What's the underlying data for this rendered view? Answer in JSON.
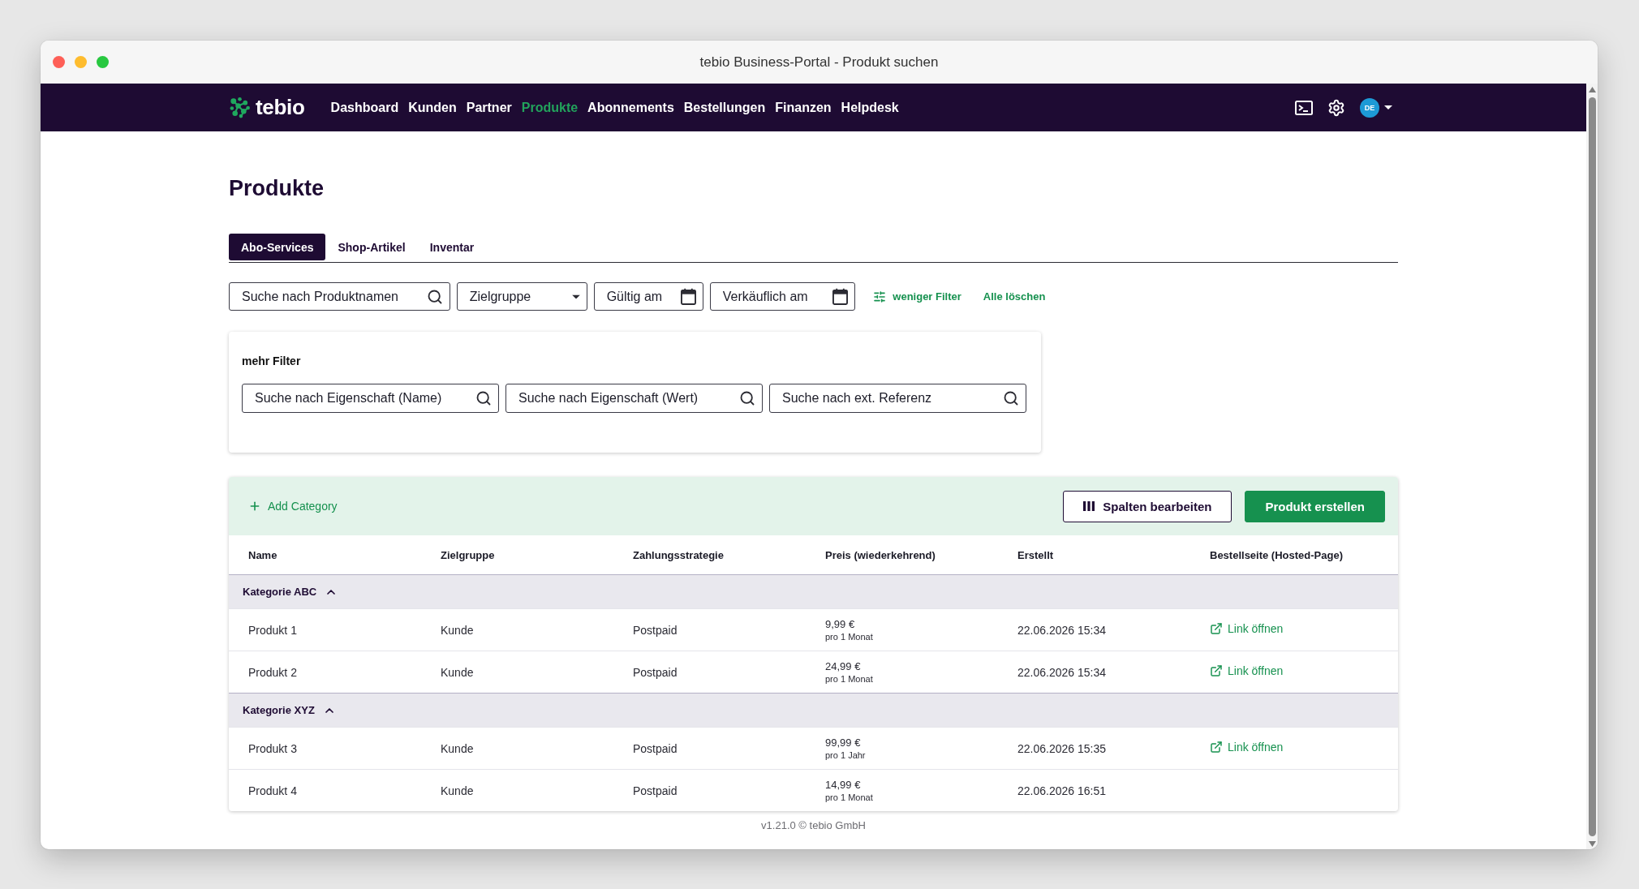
{
  "window": {
    "title": "tebio Business-Portal - Produkt suchen"
  },
  "navbar": {
    "brand": "tebio",
    "items": [
      {
        "label": "Dashboard",
        "selected": false
      },
      {
        "label": "Kunden",
        "selected": false
      },
      {
        "label": "Partner",
        "selected": false
      },
      {
        "label": "Produkte",
        "selected": true
      },
      {
        "label": "Abonnements",
        "selected": false
      },
      {
        "label": "Bestellungen",
        "selected": false
      },
      {
        "label": "Finanzen",
        "selected": false
      },
      {
        "label": "Helpdesk",
        "selected": false
      }
    ],
    "avatar": "DE"
  },
  "page": {
    "title": "Produkte"
  },
  "tabs": [
    {
      "label": "Abo-Services",
      "selected": true
    },
    {
      "label": "Shop-Artikel",
      "selected": false
    },
    {
      "label": "Inventar",
      "selected": false
    }
  ],
  "filters": {
    "fields": [
      {
        "kind": "search",
        "placeholder": "Suche nach Produktnamen"
      },
      {
        "kind": "select",
        "placeholder": "Zielgruppe"
      },
      {
        "kind": "date",
        "placeholder": "Gültig am"
      },
      {
        "kind": "date",
        "placeholder": "Verkäuflich am"
      }
    ],
    "toggle": "weniger Filter",
    "clear": "Alle löschen"
  },
  "more_filters": {
    "title": "mehr Filter",
    "fields": [
      {
        "kind": "search",
        "placeholder": "Suche nach Eigenschaft (Name)"
      },
      {
        "kind": "search",
        "placeholder": "Suche nach Eigenschaft (Wert)"
      },
      {
        "kind": "search",
        "placeholder": "Suche nach ext. Referenz"
      }
    ]
  },
  "table": {
    "add_category": "Add Category",
    "buttons": [
      {
        "kind": "outline",
        "label": "Spalten bearbeiten"
      },
      {
        "kind": "primary",
        "label": "Produkt erstellen"
      }
    ],
    "columns": [
      "Name",
      "Zielgruppe",
      "Zahlungsstrategie",
      "Preis (wiederkehrend)",
      "Erstellt",
      "Bestellseite (Hosted-Page)"
    ],
    "groups": [
      {
        "name": "Kategorie ABC",
        "expanded": true,
        "rows": [
          {
            "name": "Produkt 1",
            "audience": "Kunde",
            "payment": "Postpaid",
            "price": "9,99 €",
            "interval": "pro 1 Monat",
            "created": "22.06.2026 15:34",
            "link": "Link öffnen"
          },
          {
            "name": "Produkt 2",
            "audience": "Kunde",
            "payment": "Postpaid",
            "price": "24,99 €",
            "interval": "pro 1 Monat",
            "created": "22.06.2026 15:34",
            "link": "Link öffnen"
          }
        ]
      },
      {
        "name": "Kategorie XYZ",
        "expanded": true,
        "rows": [
          {
            "name": "Produkt 3",
            "audience": "Kunde",
            "payment": "Postpaid",
            "price": "99,99 €",
            "interval": "pro 1 Jahr",
            "created": "22.06.2026 15:35",
            "link": "Link öffnen"
          },
          {
            "name": "Produkt 4",
            "audience": "Kunde",
            "payment": "Postpaid",
            "price": "14,99 €",
            "interval": "pro 1 Monat",
            "created": "22.06.2026 16:51"
          }
        ]
      }
    ]
  },
  "footer": {
    "text": "v1.21.0 © tebio GmbH"
  }
}
